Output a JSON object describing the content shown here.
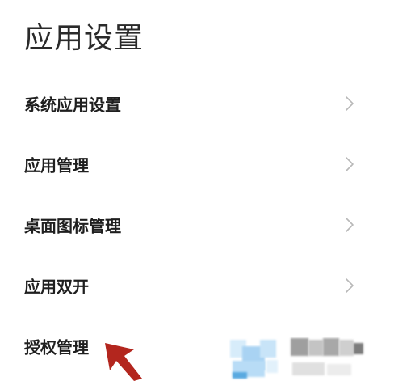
{
  "page": {
    "title": "应用设置"
  },
  "settings": {
    "items": [
      {
        "label": "系统应用设置",
        "chevron_icon": "chevron-right-icon"
      },
      {
        "label": "应用管理",
        "chevron_icon": "chevron-right-icon"
      },
      {
        "label": "桌面图标管理",
        "chevron_icon": "chevron-right-icon"
      },
      {
        "label": "应用双开",
        "chevron_icon": "chevron-right-icon"
      },
      {
        "label": "授权管理",
        "chevron_icon": "chevron-right-icon"
      }
    ]
  },
  "annotation": {
    "arrow_icon": "pointer-arrow-icon",
    "arrow_color": "#b3261e"
  },
  "colors": {
    "text": "#1f1f1f",
    "chevron": "#b8b8b8",
    "background": "#ffffff"
  }
}
